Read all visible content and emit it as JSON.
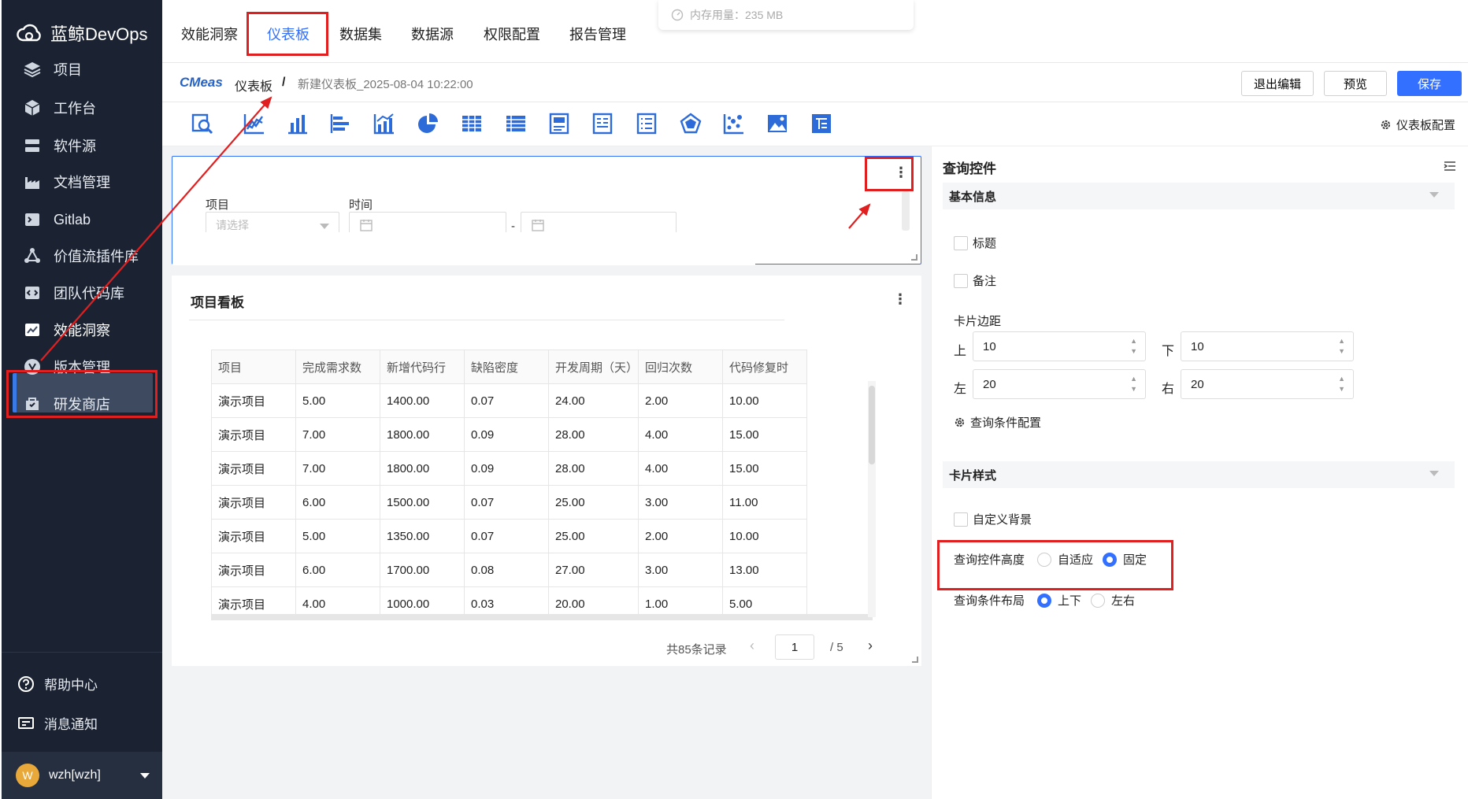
{
  "app": {
    "brand": "蓝鲸DevOps"
  },
  "sidebar": {
    "items": [
      {
        "label": "项目",
        "icon": "layers-icon"
      },
      {
        "label": "工作台",
        "icon": "cube-icon"
      },
      {
        "label": "软件源",
        "icon": "server-icon"
      },
      {
        "label": "文档管理",
        "icon": "factory-icon"
      },
      {
        "label": "Gitlab",
        "icon": "terminal-icon"
      },
      {
        "label": "价值流插件库",
        "icon": "network-icon"
      },
      {
        "label": "团队代码库",
        "icon": "code-icon"
      },
      {
        "label": "效能洞察",
        "icon": "chart-icon"
      },
      {
        "label": "版本管理",
        "icon": "version-icon"
      },
      {
        "label": "研发商店",
        "icon": "store-icon"
      }
    ],
    "bottom": [
      {
        "label": "帮助中心",
        "icon": "help-icon"
      },
      {
        "label": "消息通知",
        "icon": "message-icon"
      }
    ],
    "user": {
      "avatar": "W",
      "name": "wzh[wzh]"
    }
  },
  "tabs": [
    "效能洞察",
    "仪表板",
    "数据集",
    "数据源",
    "权限配置",
    "报告管理"
  ],
  "memory_tip": "内存用量：235 MB",
  "breadcrumb": {
    "logo": "CMeas",
    "root": "仪表板",
    "sep": "/",
    "current": "新建仪表板_2025-08-04 10:22:00"
  },
  "actions": {
    "exit_edit": "退出编辑",
    "preview": "预览",
    "save": "保存"
  },
  "toolbar": {
    "dashboard_config": "仪表板配置"
  },
  "query_card": {
    "project_label": "项目",
    "project_placeholder": "请选择",
    "time_label": "时间",
    "range_sep": "-"
  },
  "table_card": {
    "title": "项目看板",
    "columns": [
      "项目",
      "完成需求数",
      "新增代码行",
      "缺陷密度",
      "开发周期（天）",
      "回归次数",
      "代码修复时"
    ],
    "rows": [
      [
        "演示项目",
        "5.00",
        "1400.00",
        "0.07",
        "24.00",
        "2.00",
        "10.00"
      ],
      [
        "演示项目",
        "7.00",
        "1800.00",
        "0.09",
        "28.00",
        "4.00",
        "15.00"
      ],
      [
        "演示项目",
        "7.00",
        "1800.00",
        "0.09",
        "28.00",
        "4.00",
        "15.00"
      ],
      [
        "演示项目",
        "6.00",
        "1500.00",
        "0.07",
        "25.00",
        "3.00",
        "11.00"
      ],
      [
        "演示项目",
        "5.00",
        "1350.00",
        "0.07",
        "25.00",
        "2.00",
        "10.00"
      ],
      [
        "演示项目",
        "6.00",
        "1700.00",
        "0.08",
        "27.00",
        "3.00",
        "13.00"
      ],
      [
        "演示项目",
        "4.00",
        "1000.00",
        "0.03",
        "20.00",
        "1.00",
        "5.00"
      ]
    ],
    "pagination": {
      "total": "共85条记录",
      "page": "1",
      "pages": "/ 5"
    }
  },
  "panel": {
    "title": "查询控件",
    "basic": "基本信息",
    "title_chk": "标题",
    "remark_chk": "备注",
    "margin_label": "卡片边距",
    "top": "上",
    "top_val": "10",
    "bottom": "下",
    "bottom_val": "10",
    "left": "左",
    "left_val": "20",
    "right": "右",
    "right_val": "20",
    "query_config": "查询条件配置",
    "style": "卡片样式",
    "custom_bg": "自定义背景",
    "height_label": "查询控件高度",
    "height_opts": [
      "自适应",
      "固定"
    ],
    "height_selected": "固定",
    "layout_label": "查询条件布局",
    "layout_opts": [
      "上下",
      "左右"
    ],
    "layout_selected": "上下"
  },
  "colors": {
    "accent": "#3370ff",
    "sidebar": "#1b2332",
    "annotation": "#e02020"
  }
}
